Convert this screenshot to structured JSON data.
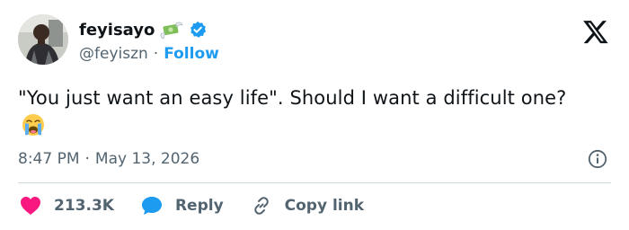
{
  "author": {
    "display_name": "feyisayo",
    "handle": "@feyiszn",
    "separator": "·",
    "follow_label": "Follow",
    "badge_emoji": "money-with-wings",
    "verified_icon": "verified-badge-icon"
  },
  "tweet": {
    "text": "\"You just want an easy life\". Should I want a difficult one?",
    "emoji": "loudly-crying-face"
  },
  "meta": {
    "time": "8:47 PM",
    "separator": "·",
    "date": "May 13, 2026"
  },
  "actions": {
    "likes": "213.3K",
    "reply_label": "Reply",
    "copy_link_label": "Copy link"
  },
  "colors": {
    "accent": "#1d9bf0",
    "like": "#f91880",
    "muted": "#536471",
    "text": "#0f1419",
    "divider": "#cfd9de"
  }
}
